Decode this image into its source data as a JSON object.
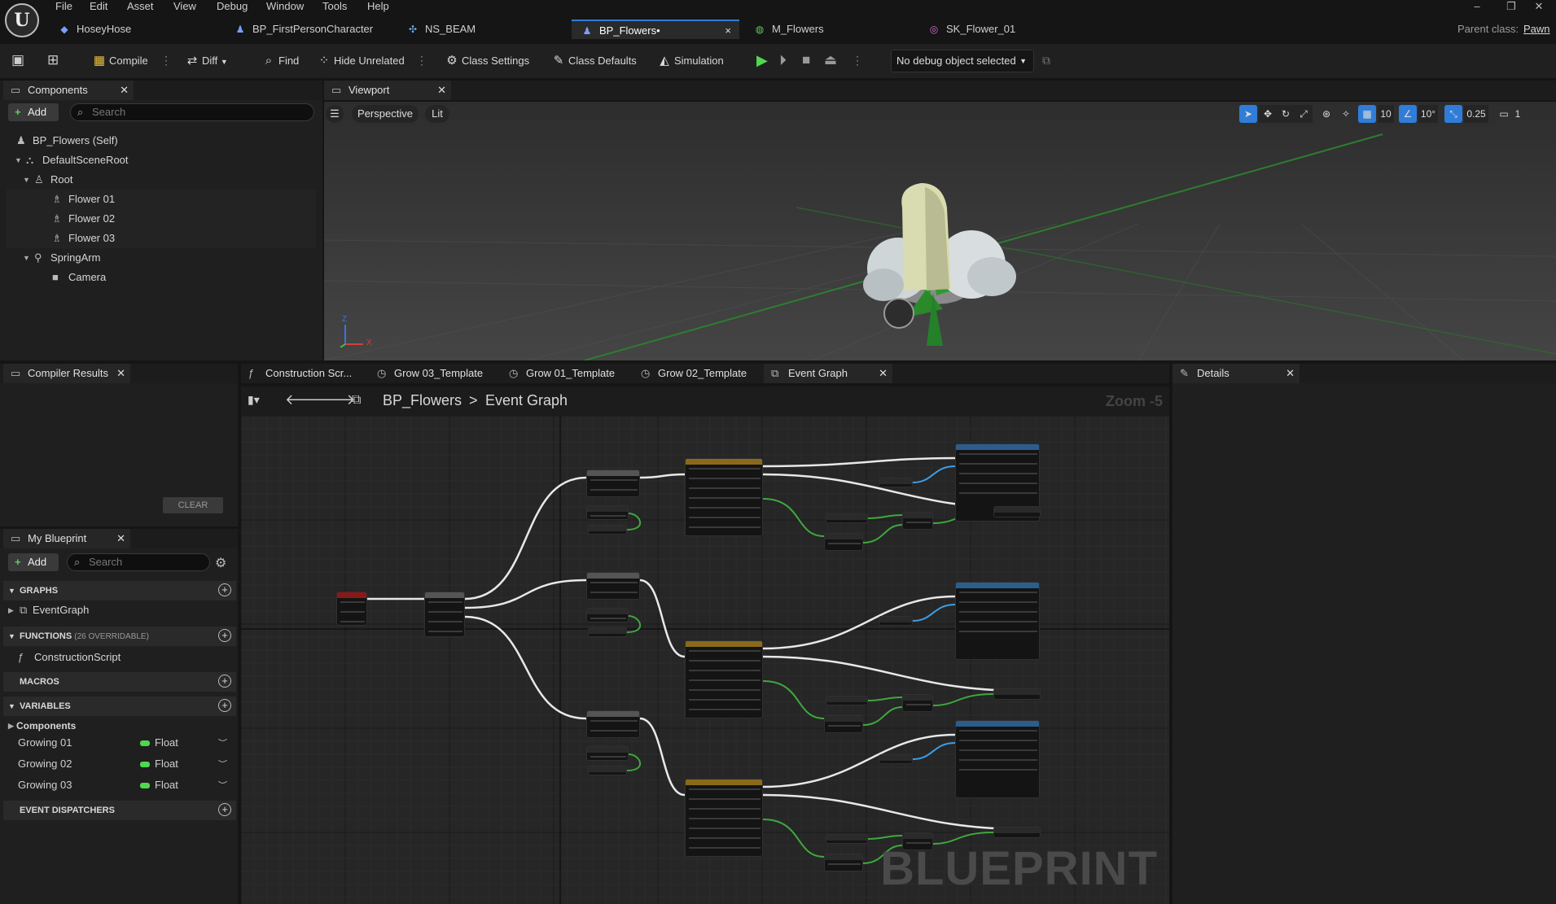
{
  "menu": [
    "File",
    "Edit",
    "Asset",
    "View",
    "Debug",
    "Window",
    "Tools",
    "Help"
  ],
  "tabs": [
    {
      "label": "HoseyHose",
      "icon": "◆",
      "color": "#7aa0ff"
    },
    {
      "label": "BP_FirstPersonCharacter",
      "icon": "♟",
      "color": "#7aa0ff"
    },
    {
      "label": "NS_BEAM",
      "icon": "✣",
      "color": "#6ab0ff"
    },
    {
      "label": "BP_Flowers•",
      "icon": "♟",
      "color": "#7aa0ff"
    },
    {
      "label": "M_Flowers",
      "icon": "◍",
      "color": "#5ec85e"
    },
    {
      "label": "SK_Flower_01",
      "icon": "◎",
      "color": "#d070d0"
    }
  ],
  "tab_close": "×",
  "parent_class_label": "Parent class:",
  "parent_class_value": "Pawn",
  "toolbar": {
    "compile": "Compile",
    "diff": "Diff",
    "find": "Find",
    "hide_unrelated": "Hide Unrelated",
    "class_settings": "Class Settings",
    "class_defaults": "Class Defaults",
    "simulation": "Simulation",
    "debug_select": "No debug object selected"
  },
  "components_panel": {
    "title": "Components",
    "add": "Add",
    "search_placeholder": "Search",
    "tree": [
      {
        "label": "BP_Flowers (Self)",
        "depth": 0,
        "icon": "♟",
        "expand": ""
      },
      {
        "label": "DefaultSceneRoot",
        "depth": 1,
        "icon": "⛬",
        "expand": "▼"
      },
      {
        "label": "Root",
        "depth": 2,
        "icon": "♙",
        "expand": "▼"
      },
      {
        "label": "Flower 01",
        "depth": 3,
        "icon": "♗",
        "expand": ""
      },
      {
        "label": "Flower 02",
        "depth": 3,
        "icon": "♗",
        "expand": ""
      },
      {
        "label": "Flower 03",
        "depth": 3,
        "icon": "♗",
        "expand": ""
      },
      {
        "label": "SpringArm",
        "depth": 2,
        "icon": "⚲",
        "expand": "▼"
      },
      {
        "label": "Camera",
        "depth": 3,
        "icon": "■",
        "expand": ""
      }
    ]
  },
  "viewport": {
    "title": "Viewport",
    "perspective": "Perspective",
    "lit": "Lit",
    "grid_snap": "10",
    "rot_snap": "10°",
    "scale_snap": "0.25",
    "cam_speed": "1",
    "axis_x": "X",
    "axis_z": "Z"
  },
  "compiler": {
    "title": "Compiler Results",
    "clear": "CLEAR"
  },
  "my_blueprint": {
    "title": "My Blueprint",
    "add": "Add",
    "search_placeholder": "Search",
    "sections": {
      "graphs": "GRAPHS",
      "functions": "FUNCTIONS",
      "functions_count": "(26 OVERRIDABLE)",
      "macros": "MACROS",
      "variables": "VARIABLES",
      "dispatchers": "EVENT DISPATCHERS"
    },
    "event_graph": "EventGraph",
    "construction_script": "ConstructionScript",
    "components_cat": "Components",
    "variables": [
      {
        "name": "Growing 01",
        "type": "Float"
      },
      {
        "name": "Growing 02",
        "type": "Float"
      },
      {
        "name": "Growing 03",
        "type": "Float"
      }
    ]
  },
  "graph_tabs": [
    {
      "label": "Construction Scr...",
      "icon": "ƒ"
    },
    {
      "label": "Grow 03_Template",
      "icon": "◷"
    },
    {
      "label": "Grow 01_Template",
      "icon": "◷"
    },
    {
      "label": "Grow 02_Template",
      "icon": "◷"
    },
    {
      "label": "Event Graph",
      "icon": "⧉"
    }
  ],
  "graph": {
    "breadcrumb_root": "BP_Flowers",
    "breadcrumb_sep": ">",
    "breadcrumb_leaf": "Event Graph",
    "zoom": "Zoom -5",
    "watermark": "BLUEPRINT"
  },
  "details": {
    "title": "Details"
  },
  "colors": {
    "accent": "#2f7dd8",
    "exec": "#ffffff",
    "float_wire": "#4ed84e",
    "object_wire": "#3ca0e8",
    "play": "#4ed84e"
  }
}
